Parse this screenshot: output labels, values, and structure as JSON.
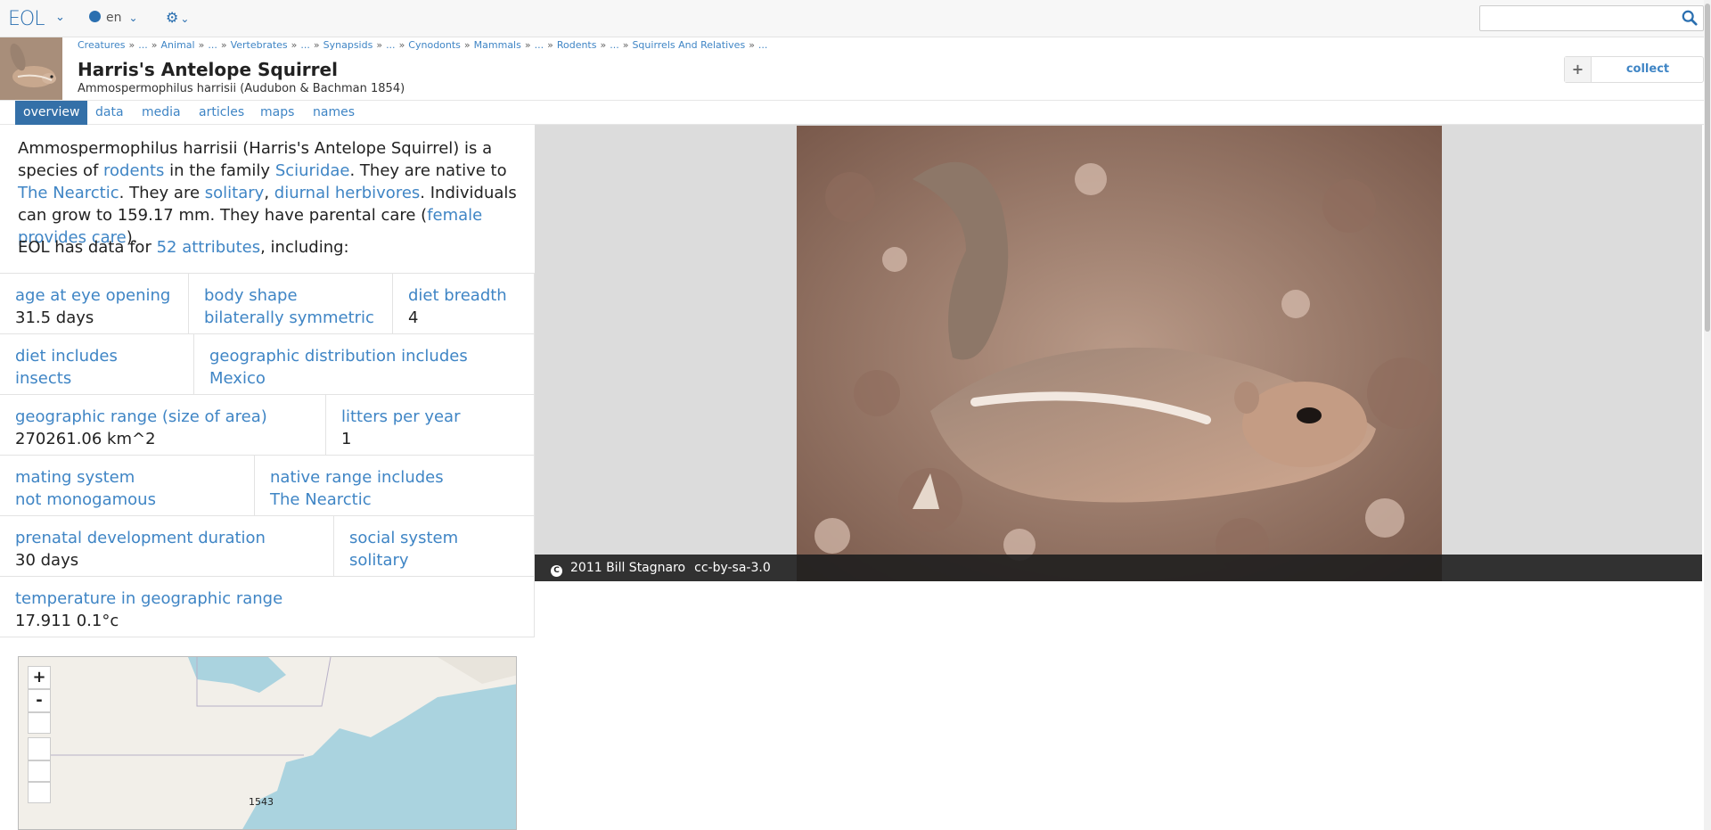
{
  "topbar": {
    "logo": "EOL",
    "language": "en",
    "search_placeholder": "",
    "search_value": ""
  },
  "taxon": {
    "breadcrumbs": [
      "Creatures",
      "...",
      "Animal",
      "...",
      "Vertebrates",
      "...",
      "Synapsids",
      "...",
      "Cynodonts",
      "Mammals",
      "...",
      "Rodents",
      "...",
      "Squirrels And Relatives",
      "..."
    ],
    "title": "Harris's Antelope Squirrel",
    "scientific_name": "Ammospermophilus harrisii (Audubon & Bachman 1854)",
    "collect_label": "collect"
  },
  "tabs": [
    "overview",
    "data",
    "media",
    "articles",
    "maps",
    "names"
  ],
  "summary": {
    "p1": "Ammospermophilus harrisii (Harris's Antelope Squirrel) is a species of ",
    "l1": "rodents",
    "p2": " in the family ",
    "l2": "Sciuridae",
    "p3": ". They are native to ",
    "l3": "The Nearctic",
    "p4": ". They are ",
    "l4": "solitary",
    "p5": ", ",
    "l5": "diurnal herbivores",
    "p6": ". Individuals can grow to 159.17 mm. They have parental care (",
    "l6": "female provides care",
    "p7": ").",
    "data_prefix": "EOL has data for ",
    "data_link": "52 attributes",
    "data_suffix": ", including:"
  },
  "attributes": [
    [
      {
        "name": "age at eye opening",
        "value": "31.5 days",
        "link": false
      },
      {
        "name": "body shape",
        "value": "bilaterally symmetric",
        "link": true
      },
      {
        "name": "diet breadth",
        "value": "4",
        "link": false
      }
    ],
    [
      {
        "name": "diet includes",
        "value": "insects",
        "link": true
      },
      {
        "name": "geographic distribution includes",
        "value": "Mexico",
        "link": true
      }
    ],
    [
      {
        "name": "geographic range (size of area)",
        "value": "270261.06 km^2",
        "link": false
      },
      {
        "name": "litters per year",
        "value": "1",
        "link": false
      }
    ],
    [
      {
        "name": "mating system",
        "value": "not monogamous",
        "link": true
      },
      {
        "name": "native range includes",
        "value": "The Nearctic",
        "link": true
      }
    ],
    [
      {
        "name": "prenatal development duration",
        "value": "30 days",
        "link": false
      },
      {
        "name": "social system",
        "value": "solitary",
        "link": true
      }
    ],
    [
      {
        "name": "temperature in geographic range",
        "value": "17.911 0.1°c",
        "link": false
      }
    ]
  ],
  "map": {
    "zoom_in": "+",
    "zoom_out": "-",
    "marker_count": "1543"
  },
  "image": {
    "credit": "2011 Bill Stagnaro",
    "license": "cc-by-sa-3.0"
  }
}
